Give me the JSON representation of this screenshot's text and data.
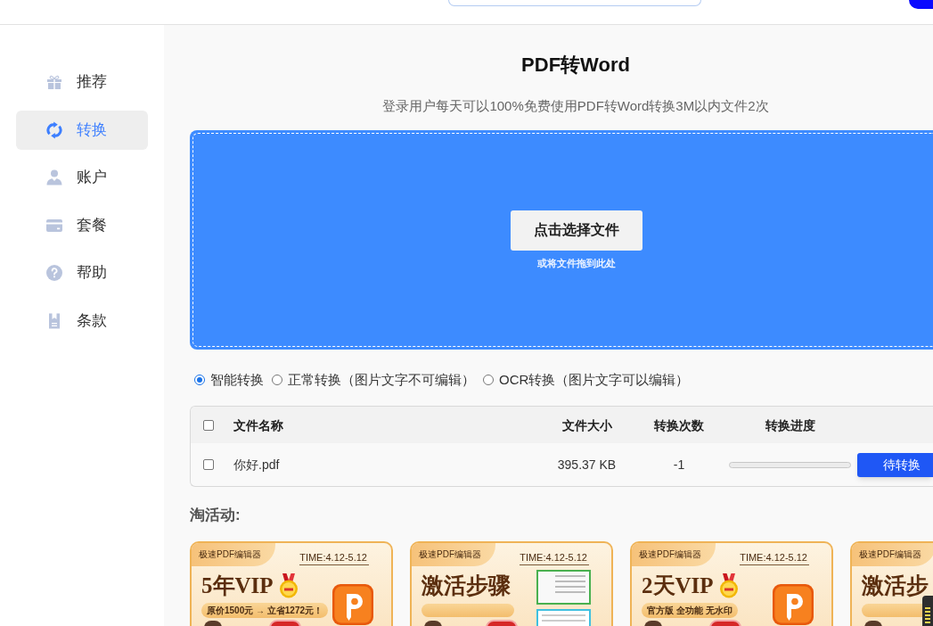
{
  "sidebar": {
    "items": [
      {
        "label": "推荐",
        "selected": false
      },
      {
        "label": "转换",
        "selected": true
      },
      {
        "label": "账户",
        "selected": false
      },
      {
        "label": "套餐",
        "selected": false
      },
      {
        "label": "帮助",
        "selected": false
      },
      {
        "label": "条款",
        "selected": false
      }
    ]
  },
  "converter": {
    "title": "PDF转Word",
    "subtitle": "登录用户每天可以100%免费使用PDF转Word转换3M以内文件2次",
    "upload": {
      "button": "点击选择文件",
      "hint": "或将文件拖到此处"
    },
    "modes": [
      {
        "label": "智能转换",
        "selected": true
      },
      {
        "label": "正常转换（图片文字不可编辑）",
        "selected": false
      },
      {
        "label": "OCR转换（图片文字可以编辑）",
        "selected": false
      }
    ],
    "table": {
      "select_all": {
        "checked": false
      },
      "columns": [
        "文件名称",
        "文件大小",
        "转换次数",
        "转换进度"
      ],
      "rows": [
        {
          "checked": false,
          "name": "你好.pdf",
          "size": "395.37 KB",
          "count": "-1",
          "action": "待转换"
        }
      ]
    }
  },
  "promotions": {
    "title": "淘活动:",
    "banners": [
      {
        "kind": "vip",
        "brand": "极速PDF编辑器",
        "time": "TIME:4.12-5.12",
        "title": "5年VIP",
        "tagline": "原价1500元 → 立省1272元！"
      },
      {
        "kind": "steps",
        "brand": "极速PDF编辑器",
        "time": "TIME:4.12-5.12",
        "title": "激活步骤"
      },
      {
        "kind": "vip",
        "brand": "极速PDF编辑器",
        "time": "TIME:4.12-5.12",
        "title": "2天VIP",
        "tagline": "官方版 全功能 无水印"
      },
      {
        "kind": "steps",
        "brand": "极速PDF编辑器",
        "title": "激活步"
      }
    ]
  }
}
